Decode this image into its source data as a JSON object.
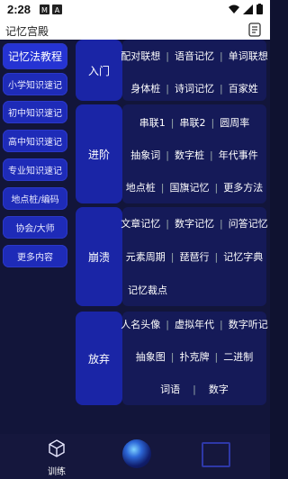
{
  "status": {
    "time": "2:28"
  },
  "app": {
    "title": "记忆宫殿"
  },
  "sidebar": {
    "items": [
      {
        "label": "记忆法教程",
        "active": true
      },
      {
        "label": "小学知识速记"
      },
      {
        "label": "初中知识速记"
      },
      {
        "label": "高中知识速记"
      },
      {
        "label": "专业知识速记"
      },
      {
        "label": "地点桩/编码"
      },
      {
        "label": "协会/大师"
      },
      {
        "label": "更多内容"
      }
    ]
  },
  "sections": [
    {
      "label": "入门",
      "rows": [
        [
          "配对联想",
          "语音记忆",
          "单词联想"
        ],
        [
          "身体桩",
          "诗词记忆",
          "百家姓"
        ]
      ]
    },
    {
      "label": "进阶",
      "rows": [
        [
          "串联1",
          "串联2",
          "圆周率"
        ],
        [
          "抽象词",
          "数字桩",
          "年代事件"
        ],
        [
          "地点桩",
          "国旗记忆",
          "更多方法"
        ]
      ]
    },
    {
      "label": "崩溃",
      "rows": [
        [
          "文章记忆",
          "数字记忆",
          "问答记忆"
        ],
        [
          "元素周期",
          "琵琶行",
          "记忆字典"
        ],
        [
          "记忆裁点"
        ]
      ]
    },
    {
      "label": "放弃",
      "rows": [
        [
          "人名头像",
          "虚拟年代",
          "数字听记"
        ],
        [
          "抽象图",
          "扑克牌",
          "二进制"
        ],
        [
          "词语",
          "数字"
        ]
      ]
    }
  ],
  "bottom_nav": {
    "train_label": "训练"
  },
  "colors": {
    "background": "#12153a",
    "button": "#1e2bb8",
    "section": "#1a25a6"
  }
}
